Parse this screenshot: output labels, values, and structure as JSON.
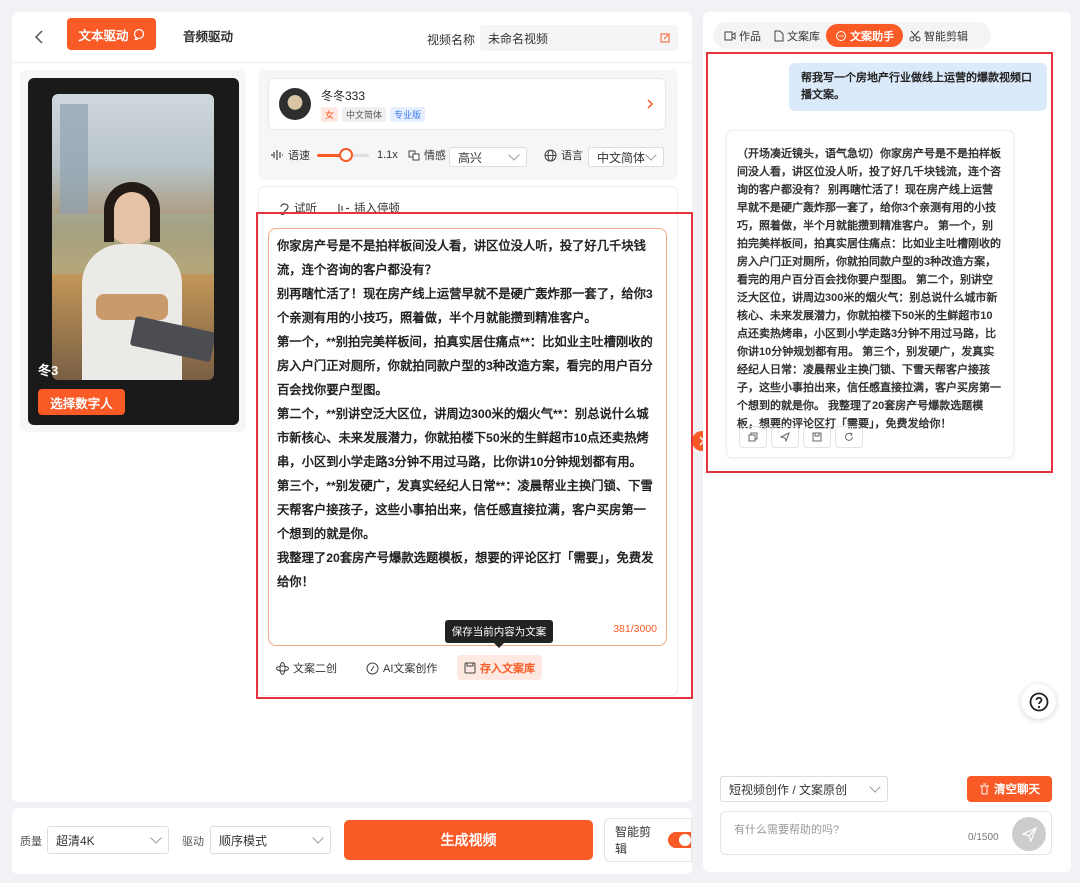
{
  "header": {
    "tab_text_drive": "文本驱动",
    "tab_audio_drive": "音频驱动",
    "video_name_label": "视频名称",
    "video_name_value": "未命名视频"
  },
  "avatar_card": {
    "name": "冬3",
    "select_button": "选择数字人"
  },
  "voice": {
    "name": "冬冬333",
    "tag_gender": "女",
    "tag_lang": "中文简体",
    "tag_pro": "专业版",
    "speed_label": "语速",
    "speed_value": "1.1x",
    "speed_level": 0.55,
    "emotion_label": "情感",
    "emotion_value": "高兴",
    "language_label": "语言",
    "language_value": "中文简体"
  },
  "editor": {
    "tool_listen": "试听",
    "tool_pause": "插入停顿",
    "paragraphs": [
      "你家房产号是不是拍样板间没人看，讲区位没人听，投了好几千块钱流，连个咨询的客户都没有？",
      "别再瞎忙活了！现在房产线上运营早就不是硬广轰炸那一套了，给你3个亲测有用的小技巧，照着做，半个月就能攒到精准客户。",
      "第一个，**别拍完美样板间，拍真实居住痛点**：比如业主吐槽刚收的房入户门正对厕所，你就拍同款户型的3种改造方案，看完的用户百分百会找你要户型图。",
      "第二个，**别讲空泛大区位，讲周边300米的烟火气**：别总说什么城市新核心、未来发展潜力，你就拍楼下50米的生鲜超市10点还卖热烤串，小区到小学走路3分钟不用过马路，比你讲10分钟规划都有用。",
      "第三个，**别发硬广，发真实经纪人日常**：凌晨帮业主换门锁、下雪天帮客户接孩子，这些小事拍出来，信任感直接拉满，客户买房第一个想到的就是你。",
      "我整理了20套房产号爆款选题模板，想要的评论区打「需要」，免费发给你！"
    ],
    "char_count": "381/3000",
    "tooltip": "保存当前内容为文案",
    "action_rewrite": "文案二创",
    "action_ai": "AI文案创作",
    "action_save": "存入文案库"
  },
  "bottom_bar": {
    "quality_label": "质量",
    "quality_value": "超清4K",
    "drive_label": "驱动",
    "drive_value": "顺序模式",
    "generate_button": "生成视频",
    "smart_edit_label": "智能剪辑"
  },
  "right_tabs": [
    "作品",
    "文案库",
    "文案助手",
    "智能剪辑"
  ],
  "chat": {
    "user_message": "帮我写一个房地产行业做线上运营的爆款视频口播文案。",
    "assistant_message": "（开场凑近镜头，语气急切）你家房产号是不是拍样板间没人看，讲区位没人听，投了好几千块钱流，连个咨询的客户都没有？ 别再瞎忙活了！现在房产线上运营早就不是硬广轰炸那一套了，给你3个亲测有用的小技巧，照着做，半个月就能攒到精准客户。 第一个，别拍完美样板间，拍真实居住痛点：比如业主吐槽刚收的房入户门正对厕所，你就拍同款户型的3种改造方案，看完的用户百分百会找你要户型图。 第二个，别讲空泛大区位，讲周边300米的烟火气：别总说什么城市新核心、未来发展潜力，你就拍楼下50米的生鲜超市10点还卖热烤串，小区到小学走路3分钟不用过马路，比你讲10分钟规划都有用。 第三个，别发硬广，发真实经纪人日常：凌晨帮业主换门锁、下雪天帮客户接孩子，这些小事拍出来，信任感直接拉满，客户买房第一个想到的就是你。 我整理了20套房产号爆款选题模板，想要的评论区打「需要」，免费发给你！",
    "mode_value": "短视频创作 / 文案原创",
    "clear_button": "清空聊天",
    "input_placeholder": "有什么需要帮助的吗?",
    "input_count": "0/1500"
  },
  "colors": {
    "accent": "#fa5a26",
    "frame": "#e5333f"
  }
}
